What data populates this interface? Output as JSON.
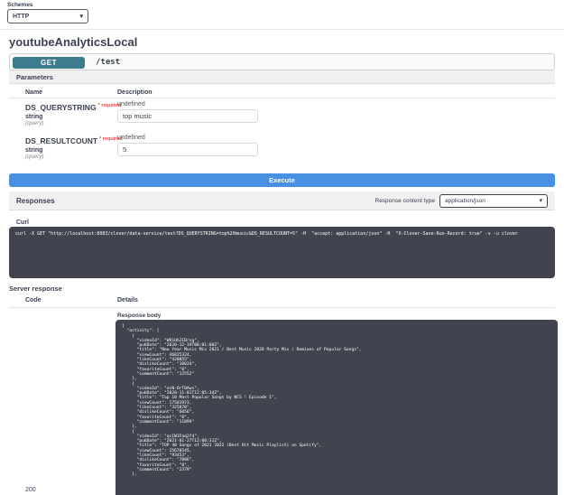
{
  "schemes": {
    "label": "Schemes",
    "selected": "HTTP"
  },
  "api": {
    "title": "youtubeAnalyticsLocal"
  },
  "operation": {
    "method": "GET",
    "path": "/test"
  },
  "icons": {
    "chevron_down": "▾"
  },
  "parameters": {
    "section_title": "Parameters",
    "columns": {
      "name": "Name",
      "description": "Description"
    },
    "rows": [
      {
        "name": "DS_QUERYSTRING",
        "required": "* required",
        "type": "string",
        "in": "(query)",
        "description": "undefined",
        "value": "top music"
      },
      {
        "name": "DS_RESULTCOUNT",
        "required": "* required",
        "type": "string",
        "in": "(query)",
        "description": "undefined",
        "value": "5"
      }
    ],
    "execute_label": "Execute"
  },
  "responses": {
    "section_title": "Responses",
    "content_type_label": "Response content type",
    "content_type_value": "application/json",
    "curl_label": "Curl",
    "curl_command": "curl -X GET \"http://localhost:8083/clover/data-service/test?DS_QUERYSTRING=top%20music&DS_RESULTCOUNT=5\" -H  \"accept: application/json\" -H  \"X-Clover-Save-Run-Record: true\" -v -u clover",
    "server_response_label": "Server response",
    "columns": {
      "code": "Code",
      "details": "Details"
    },
    "status_code": "200",
    "response_body_label": "Response body",
    "response_body": "{\n  \"activity\": [\n    {\n      \"videoId\": \"W91Uh2IBrsg\",\n      \"pubDate\": \"2020-12-19T00:01:00Z\",\n      \"title\": \"New Year Music Mix 2021 ♪ Best Music 2020 Party Mix ♪ Remixes of Popular Songs\",\n      \"viewCount\": 46825324,\n      \"likeCount\": \"420055\",\n      \"dislikeCount\": \"10024\",\n      \"favoriteCount\": \"0\",\n      \"commentCount\": \"12552\"\n    },\n    {\n      \"videoId\": \"eiN-OrT0Aws\",\n      \"pubDate\": \"2020-11-01T12:05:34Z\",\n      \"title\": \"Top 10 Most Popular Songs by NCS ! Episode 1\",\n      \"viewCount\": 17501973,\n      \"likeCount\": \"325070\",\n      \"dislikeCount\": \"6056\",\n      \"favoriteCount\": \"0\",\n      \"commentCount\": \"11899\"\n    },\n    {\n      \"videoId\": \"qcIWIFaq2f4\",\n      \"pubDate\": \"2021-01-27T12:00:31Z\",\n      \"title\": \"TOP 40 Songs of 2021 2022 (Best Hit Music Playlist) on Spotify\",\n      \"viewCount\": 15670545,\n      \"likeCount\": \"93453\",\n      \"dislikeCount\": \"7886\",\n      \"favoriteCount\": \"0\",\n      \"commentCount\": \"2379\"\n    },"
  },
  "colors": {
    "method_badge": "#3e7b8f",
    "execute_button": "#4a90e2",
    "code_block_bg": "#41444e",
    "required_red": "#f93e3e",
    "section_bar_bg": "#f0f0f0"
  }
}
